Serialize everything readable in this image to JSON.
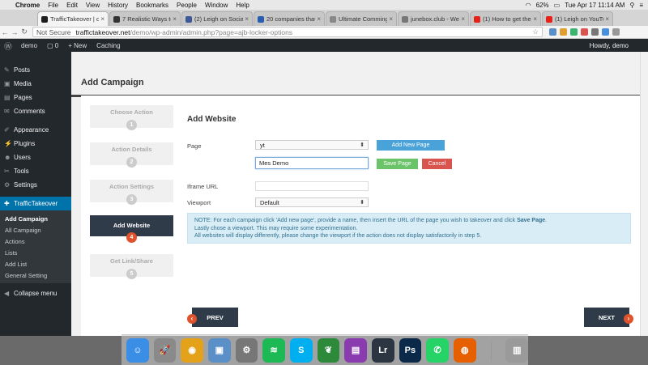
{
  "mac_menu": {
    "app": "Chrome",
    "items": [
      "File",
      "Edit",
      "View",
      "History",
      "Bookmarks",
      "People",
      "Window",
      "Help"
    ],
    "battery": "62%",
    "clock": "Tue Apr 17  11:14 AM"
  },
  "tabs": [
    {
      "title": "TrafficTakeover | d",
      "color": "#1e1e1e",
      "active": true
    },
    {
      "title": "7 Realistic Ways to",
      "color": "#333333",
      "active": false
    },
    {
      "title": "(2) Leigh on Social",
      "color": "#3b5998",
      "active": false
    },
    {
      "title": "20 companies that",
      "color": "#2a5db0",
      "active": false
    },
    {
      "title": "Ultimate Comming",
      "color": "#888888",
      "active": false
    },
    {
      "title": "junebox.club - We",
      "color": "#777777",
      "active": false
    },
    {
      "title": "(1) How to get the",
      "color": "#e62117",
      "active": false
    },
    {
      "title": "(1) Leigh on YouTub",
      "color": "#e62117",
      "active": false
    }
  ],
  "address": {
    "security": "Not Secure",
    "host": "traffictakeover.net",
    "path": "/demo/wp-admin/admin.php?page=ajb-locker-options"
  },
  "wp_bar": {
    "site": "demo",
    "comments": "0",
    "new": "New",
    "caching": "Caching",
    "howdy": "Howdy, demo"
  },
  "sidebar": {
    "items": [
      {
        "label": "Posts",
        "icon": "pin-icon"
      },
      {
        "label": "Media",
        "icon": "media-icon"
      },
      {
        "label": "Pages",
        "icon": "page-icon"
      },
      {
        "label": "Comments",
        "icon": "comment-icon"
      },
      {
        "label": "Appearance",
        "icon": "brush-icon"
      },
      {
        "label": "Plugins",
        "icon": "plug-icon"
      },
      {
        "label": "Users",
        "icon": "user-icon"
      },
      {
        "label": "Tools",
        "icon": "wrench-icon"
      },
      {
        "label": "Settings",
        "icon": "settings-icon"
      }
    ],
    "active": "TrafficTakeover",
    "submenu": [
      "Add Campaign",
      "All Campaign",
      "Actions",
      "Lists",
      "Add List",
      "General Setting"
    ],
    "collapse": "Collapse menu"
  },
  "page": {
    "title": "Add Campaign"
  },
  "steps": [
    {
      "label": "Choose Action",
      "num": "1"
    },
    {
      "label": "Action Details",
      "num": "2"
    },
    {
      "label": "Action Settings",
      "num": "3"
    },
    {
      "label": "Add Website",
      "num": "4",
      "active": true
    },
    {
      "label": "Get Link/Share",
      "num": "5"
    }
  ],
  "form": {
    "title": "Add Website",
    "page_label": "Page",
    "page_value": "yt",
    "add_new_page": "Add New Page",
    "page_name_value": "Mes Demo",
    "save_page": "Save Page",
    "cancel": "Cancel",
    "iframe_label": "Iframe URL",
    "iframe_value": "",
    "viewport_label": "Viewport",
    "viewport_value": "Default"
  },
  "note": {
    "line1_pre": "NOTE: For each campaign click 'Add new page', provide a name, then insert the URL of the page you wish to takeover and click ",
    "line1_bold": "Save Page",
    "line1_post": ".",
    "line2": "Lastly chose a viewport. This may require some experimentation.",
    "line3": "All websites will display differently, please change the viewport if the action does not display satisfactorily in step 5."
  },
  "nav": {
    "prev": "PREV",
    "next": "NEXT",
    "prev_arrow": "‹",
    "next_arrow": "›"
  },
  "dock": [
    {
      "name": "Finder",
      "glyph": "☺",
      "color": "#3a8ee6"
    },
    {
      "name": "Launchpad",
      "glyph": "🚀",
      "color": "#8a8a8a"
    },
    {
      "name": "Chrome",
      "glyph": "◉",
      "color": "#e3a21a"
    },
    {
      "name": "Preview",
      "glyph": "▣",
      "color": "#5b8fc7"
    },
    {
      "name": "System Preferences",
      "glyph": "⚙",
      "color": "#777777"
    },
    {
      "name": "Spotify",
      "glyph": "≋",
      "color": "#1db954"
    },
    {
      "name": "Skype",
      "glyph": "S",
      "color": "#00aff0"
    },
    {
      "name": "Evernote",
      "glyph": "❦",
      "color": "#2d8a3b"
    },
    {
      "name": "Photo Booth",
      "glyph": "▤",
      "color": "#8a3bb0"
    },
    {
      "name": "Lightroom",
      "glyph": "Lr",
      "color": "#2b3642"
    },
    {
      "name": "Photoshop",
      "glyph": "Ps",
      "color": "#0b2a4a"
    },
    {
      "name": "WhatsApp",
      "glyph": "✆",
      "color": "#25d366"
    },
    {
      "name": "Firefox",
      "glyph": "◍",
      "color": "#e66000"
    },
    {
      "name": "Trash",
      "glyph": "▥",
      "color": "#9a9a9a"
    }
  ]
}
